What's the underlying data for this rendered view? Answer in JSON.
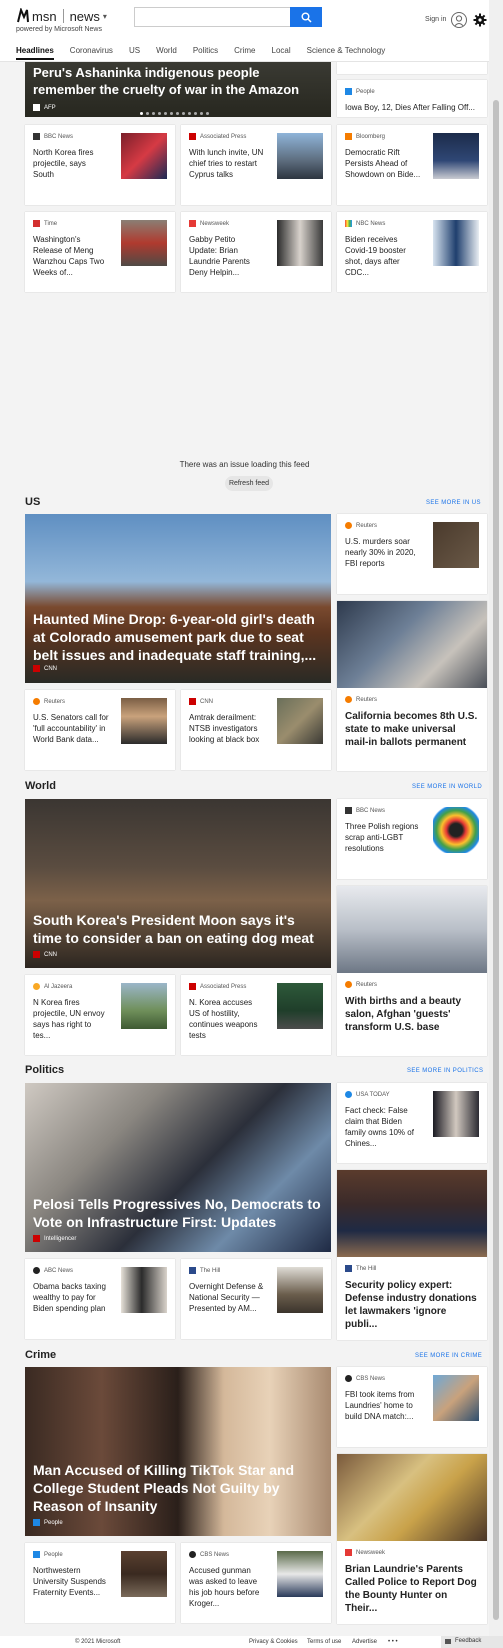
{
  "header": {
    "brand": "msn",
    "section": "news",
    "powered_by": "powered by Microsoft News",
    "search_value": "",
    "signin": "Sign in"
  },
  "nav": [
    "Headlines",
    "Coronavirus",
    "US",
    "World",
    "Politics",
    "Crime",
    "Local",
    "Science & Technology"
  ],
  "top": {
    "hero": {
      "title": "Peru's Ashaninka indigenous people remember the cruelty of war in the Amazon",
      "source": "AFP"
    },
    "side_card": {
      "source": "People",
      "title": "Iowa Boy, 12, Dies After Falling Off..."
    },
    "row1": [
      {
        "source": "BBC News",
        "title": "North Korea fires projectile, says South"
      },
      {
        "source": "Associated Press",
        "title": "With lunch invite, UN chief tries to restart Cyprus talks"
      },
      {
        "source": "Bloomberg",
        "title": "Democratic Rift Persists Ahead of Showdown on Bide..."
      }
    ],
    "row2": [
      {
        "source": "Time",
        "title": "Washington's Release of Meng Wanzhou Caps Two Weeks of..."
      },
      {
        "source": "Newsweek",
        "title": "Gabby Petito Update: Brian Laundrie Parents Deny Helpin..."
      },
      {
        "source": "NBC News",
        "title": "Biden receives Covid-19 booster shot, days after CDC..."
      }
    ]
  },
  "feed": {
    "issue": "There was an issue loading this feed",
    "refresh": "Refresh feed"
  },
  "us": {
    "heading": "US",
    "see_more": "SEE MORE IN US",
    "hero": {
      "title": "Haunted Mine Drop: 6-year-old girl's death at Colorado amusement park due to seat belt issues and inadequate staff training,...",
      "source": "CNN"
    },
    "side_card": {
      "source": "Reuters",
      "title": "U.S. murders soar nearly 30% in 2020, FBI reports"
    },
    "tall_card": {
      "source": "Reuters",
      "title": "California becomes 8th U.S. state to make universal mail-in ballots permanent"
    },
    "bottom": [
      {
        "source": "Reuters",
        "title": "U.S. Senators call for 'full accountability' in World Bank data..."
      },
      {
        "source": "CNN",
        "title": "Amtrak derailment: NTSB investigators looking at black box"
      }
    ]
  },
  "world": {
    "heading": "World",
    "see_more": "SEE MORE IN WORLD",
    "hero": {
      "title": "South Korea's President Moon says it's time to consider a ban on eating dog meat",
      "source": "CNN"
    },
    "side_card": {
      "source": "BBC News",
      "title": "Three Polish regions scrap anti-LGBT resolutions"
    },
    "tall_card": {
      "source": "Reuters",
      "title": "With births and a beauty salon, Afghan 'guests' transform U.S. base"
    },
    "bottom": [
      {
        "source": "Al Jazeera",
        "title": "N Korea fires projectile, UN envoy says has right to tes..."
      },
      {
        "source": "Associated Press",
        "title": "N. Korea accuses US of hostility, continues weapons tests"
      }
    ]
  },
  "politics": {
    "heading": "Politics",
    "see_more": "SEE MORE IN POLITICS",
    "hero": {
      "title": "Pelosi Tells Progressives No, Democrats to Vote on Infrastructure First: Updates",
      "source": "Intelligencer"
    },
    "side_card": {
      "source": "USA TODAY",
      "title": "Fact check: False claim that Biden family owns 10% of Chines..."
    },
    "tall_card": {
      "source": "The Hill",
      "title": "Security policy expert: Defense industry donations let lawmakers 'ignore publi..."
    },
    "bottom": [
      {
        "source": "ABC News",
        "title": "Obama backs taxing wealthy to pay for Biden spending plan"
      },
      {
        "source": "The Hill",
        "title": "Overnight Defense & National Security — Presented by AM..."
      }
    ]
  },
  "crime": {
    "heading": "Crime",
    "see_more": "SEE MORE IN CRIME",
    "hero": {
      "title": "Man Accused of Killing TikTok Star and College Student Pleads Not Guilty by Reason of Insanity",
      "source": "People"
    },
    "side_card": {
      "source": "CBS News",
      "title": "FBI took items from Laundries' home to build DNA match:..."
    },
    "tall_card": {
      "source": "Newsweek",
      "title": "Brian Laundrie's Parents Called Police to Report Dog the Bounty Hunter on Their..."
    },
    "bottom": [
      {
        "source": "People",
        "title": "Northwestern University Suspends Fraternity Events..."
      },
      {
        "source": "CBS News",
        "title": "Accused gunman was asked to leave his job hours before Kroger..."
      }
    ]
  },
  "footer": {
    "copyright": "© 2021 Microsoft",
    "privacy": "Privacy & Cookies",
    "terms": "Terms of use",
    "advertise": "Advertise",
    "more": "• • •",
    "feedback": "Feedback"
  },
  "colors": {
    "accent": "#1a73e8",
    "cnn": "#cc0000",
    "reuters": "#f57c00",
    "people": "#1e88e5"
  }
}
